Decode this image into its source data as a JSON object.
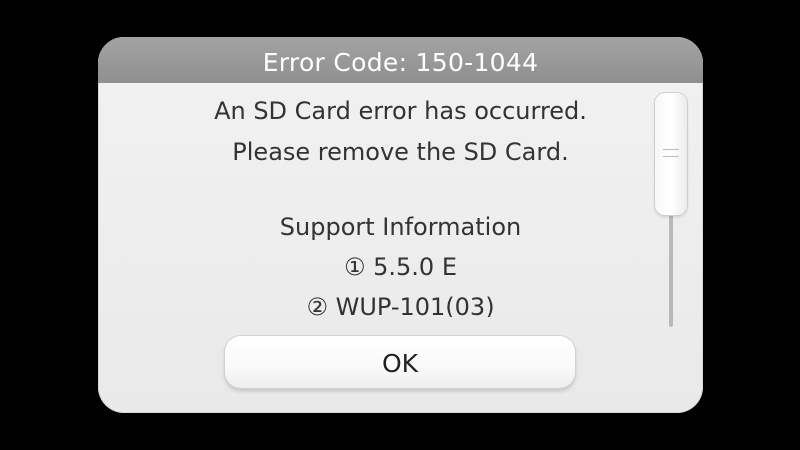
{
  "dialog": {
    "title": "Error Code: 150-1044",
    "message": {
      "line1": "An SD Card error has occurred.",
      "line2": "Please remove the SD Card.",
      "support_heading": "Support Information",
      "support_item_1": "① 5.5.0 E",
      "support_item_2": "② WUP-101(03)"
    },
    "ok_label": "OK"
  }
}
